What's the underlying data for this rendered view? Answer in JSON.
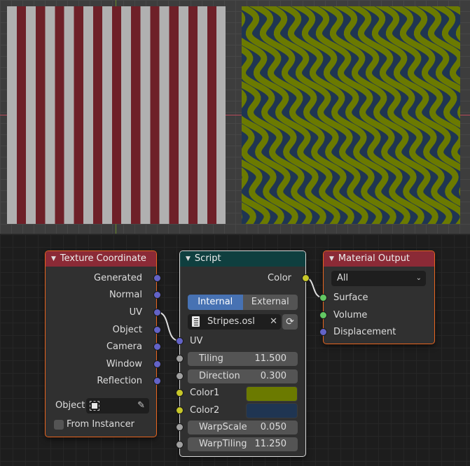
{
  "viewers": [
    {
      "name": "stripes-preview",
      "colors": [
        "#b0b0b0",
        "#6e2028"
      ]
    },
    {
      "name": "waves-preview",
      "colors": [
        "#6b7a00",
        "#1f3552"
      ]
    }
  ],
  "nodes": {
    "texture_coordinate": {
      "title": "Texture Coordinate",
      "outputs": [
        "Generated",
        "Normal",
        "UV",
        "Object",
        "Camera",
        "Window",
        "Reflection"
      ],
      "object_label": "Object",
      "object_value": "",
      "from_instancer_label": "From Instancer",
      "from_instancer_checked": false
    },
    "script": {
      "title": "Script",
      "output": "Color",
      "mode_options": [
        "Internal",
        "External"
      ],
      "mode_selected": "Internal",
      "script_name": "Stripes.osl",
      "uv_input": "UV",
      "inputs": [
        {
          "label": "Tiling",
          "value": "11.500"
        },
        {
          "label": "Direction",
          "value": "0.300"
        }
      ],
      "color1": {
        "label": "Color1",
        "value": "#6b7a00"
      },
      "color2": {
        "label": "Color2",
        "value": "#1f3552"
      },
      "inputs2": [
        {
          "label": "WarpScale",
          "value": "0.050"
        },
        {
          "label": "WarpTiling",
          "value": "11.250"
        }
      ]
    },
    "material_output": {
      "title": "Material Output",
      "target": "All",
      "inputs": [
        "Surface",
        "Volume",
        "Displacement"
      ]
    }
  },
  "links": [
    {
      "from": "Texture Coordinate.UV",
      "to": "Script.UV"
    },
    {
      "from": "Script.Color",
      "to": "Material Output.Surface"
    }
  ]
}
